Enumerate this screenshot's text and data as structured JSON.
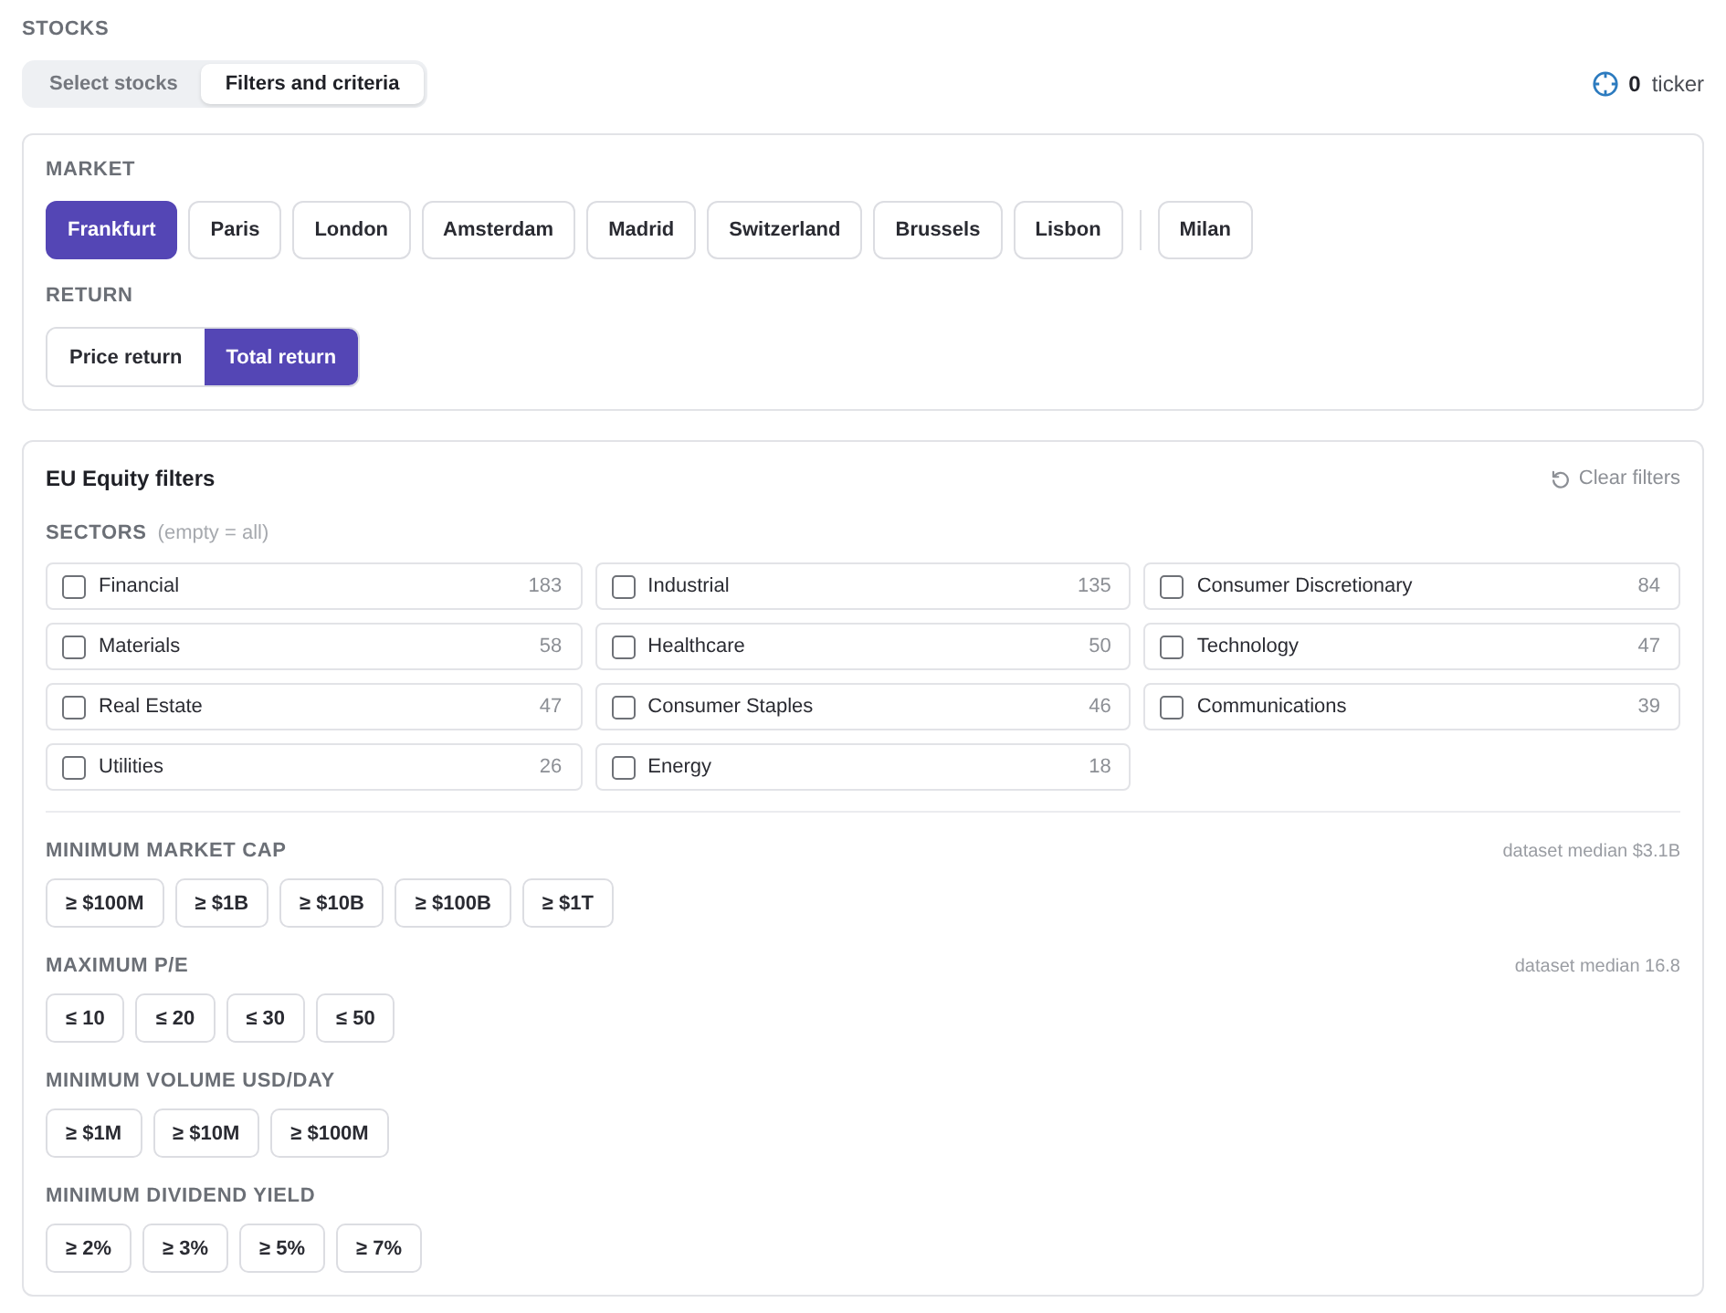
{
  "section_title": "STOCKS",
  "tabs": [
    {
      "label": "Select stocks",
      "selected": false
    },
    {
      "label": "Filters and criteria",
      "selected": true
    }
  ],
  "ticker_counter": {
    "count": "0",
    "label": "ticker"
  },
  "market": {
    "label": "MARKET",
    "groups": [
      {
        "options": [
          {
            "label": "Frankfurt",
            "selected": true
          },
          {
            "label": "Paris",
            "selected": false
          },
          {
            "label": "London",
            "selected": false
          },
          {
            "label": "Amsterdam",
            "selected": false
          },
          {
            "label": "Madrid",
            "selected": false
          },
          {
            "label": "Switzerland",
            "selected": false
          },
          {
            "label": "Brussels",
            "selected": false
          },
          {
            "label": "Lisbon",
            "selected": false
          }
        ]
      },
      {
        "options": [
          {
            "label": "Milan",
            "selected": false
          }
        ]
      }
    ]
  },
  "return": {
    "label": "RETURN",
    "options": [
      {
        "label": "Price return",
        "selected": false
      },
      {
        "label": "Total return",
        "selected": true
      }
    ]
  },
  "filters": {
    "title": "EU Equity filters",
    "clear_button": "Clear filters",
    "sectors": {
      "label": "SECTORS",
      "hint": "(empty = all)",
      "items": [
        {
          "name": "Financial",
          "count": "183",
          "checked": false
        },
        {
          "name": "Industrial",
          "count": "135",
          "checked": false
        },
        {
          "name": "Consumer Discretionary",
          "count": "84",
          "checked": false
        },
        {
          "name": "Materials",
          "count": "58",
          "checked": false
        },
        {
          "name": "Healthcare",
          "count": "50",
          "checked": false
        },
        {
          "name": "Technology",
          "count": "47",
          "checked": false
        },
        {
          "name": "Real Estate",
          "count": "47",
          "checked": false
        },
        {
          "name": "Consumer Staples",
          "count": "46",
          "checked": false
        },
        {
          "name": "Communications",
          "count": "39",
          "checked": false
        },
        {
          "name": "Utilities",
          "count": "26",
          "checked": false
        },
        {
          "name": "Energy",
          "count": "18",
          "checked": false
        }
      ]
    },
    "criteria": [
      {
        "label": "MINIMUM MARKET CAP",
        "note": "dataset median $3.1B",
        "options": [
          {
            "label": "≥ $100M",
            "selected": false
          },
          {
            "label": "≥ $1B",
            "selected": false
          },
          {
            "label": "≥ $10B",
            "selected": false
          },
          {
            "label": "≥ $100B",
            "selected": false
          },
          {
            "label": "≥ $1T",
            "selected": false
          }
        ]
      },
      {
        "label": "MAXIMUM P/E",
        "note": "dataset median 16.8",
        "options": [
          {
            "label": "≤ 10",
            "selected": false
          },
          {
            "label": "≤ 20",
            "selected": false
          },
          {
            "label": "≤ 30",
            "selected": false
          },
          {
            "label": "≤ 50",
            "selected": false
          }
        ]
      },
      {
        "label": "MINIMUM VOLUME USD/DAY",
        "options": [
          {
            "label": "≥ $1M",
            "selected": false
          },
          {
            "label": "≥ $10M",
            "selected": false
          },
          {
            "label": "≥ $100M",
            "selected": false
          }
        ]
      },
      {
        "label": "MINIMUM DIVIDEND YIELD",
        "options": [
          {
            "label": "≥ 2%",
            "selected": false
          },
          {
            "label": "≥ 3%",
            "selected": false
          },
          {
            "label": "≥ 5%",
            "selected": false
          },
          {
            "label": "≥ 7%",
            "selected": false
          }
        ]
      }
    ]
  }
}
